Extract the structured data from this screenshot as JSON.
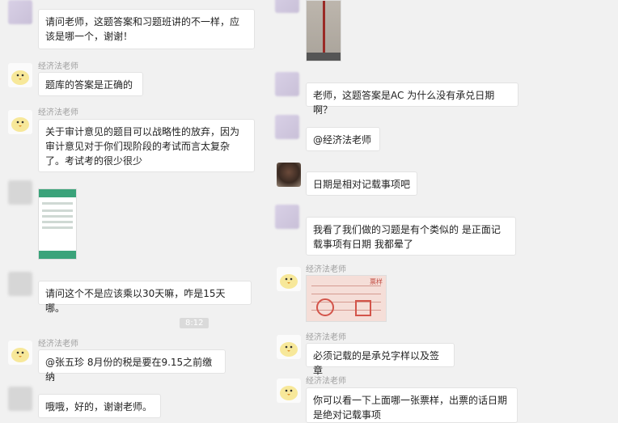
{
  "left": {
    "messages": [
      {
        "sender": "",
        "text": "请问老师，这题答案和习题班讲的不一样，应该是哪一个，谢谢！"
      },
      {
        "sender": "经济法老师",
        "text": "题库的答案是正确的"
      },
      {
        "sender": "经济法老师",
        "text": "关于审计意见的题目可以战略性的放弃，因为审计意见对于你们现阶段的考试而言太复杂了。考试考的很少很少"
      },
      {
        "sender": "",
        "text": ""
      },
      {
        "sender": "",
        "text": "请问这个不是应该乘以30天嘛，咋是15天哪。"
      },
      {
        "sender": "经济法老师",
        "text": "@张五珍  8月份的税是要在9.15之前缴纳"
      },
      {
        "sender": "",
        "text": "哦哦，好的，谢谢老师。"
      }
    ],
    "timestamp": "8:12"
  },
  "right": {
    "messages": [
      {
        "sender": "",
        "text": ""
      },
      {
        "sender": "",
        "text": "老师，这题答案是AC 为什么没有承兑日期啊？"
      },
      {
        "sender": "",
        "text": "@经济法老师"
      },
      {
        "sender": "",
        "text": "日期是相对记载事项吧"
      },
      {
        "sender": "",
        "text": "我看了我们做的习题是有个类似的 是正面记载事项有日期 我都晕了"
      },
      {
        "sender": "经济法老师",
        "text": ""
      },
      {
        "sender": "经济法老师",
        "text": "必须记载的是承兑字样以及签章"
      },
      {
        "sender": "经济法老师",
        "text": "你可以看一下上面哪一张票样，出票的话日期是绝对记载事项"
      }
    ],
    "stamp_label": "票样"
  },
  "colors": {
    "bubble": "#ffffff",
    "background": "#f1f1f1",
    "sender": "#a0a0a0"
  }
}
